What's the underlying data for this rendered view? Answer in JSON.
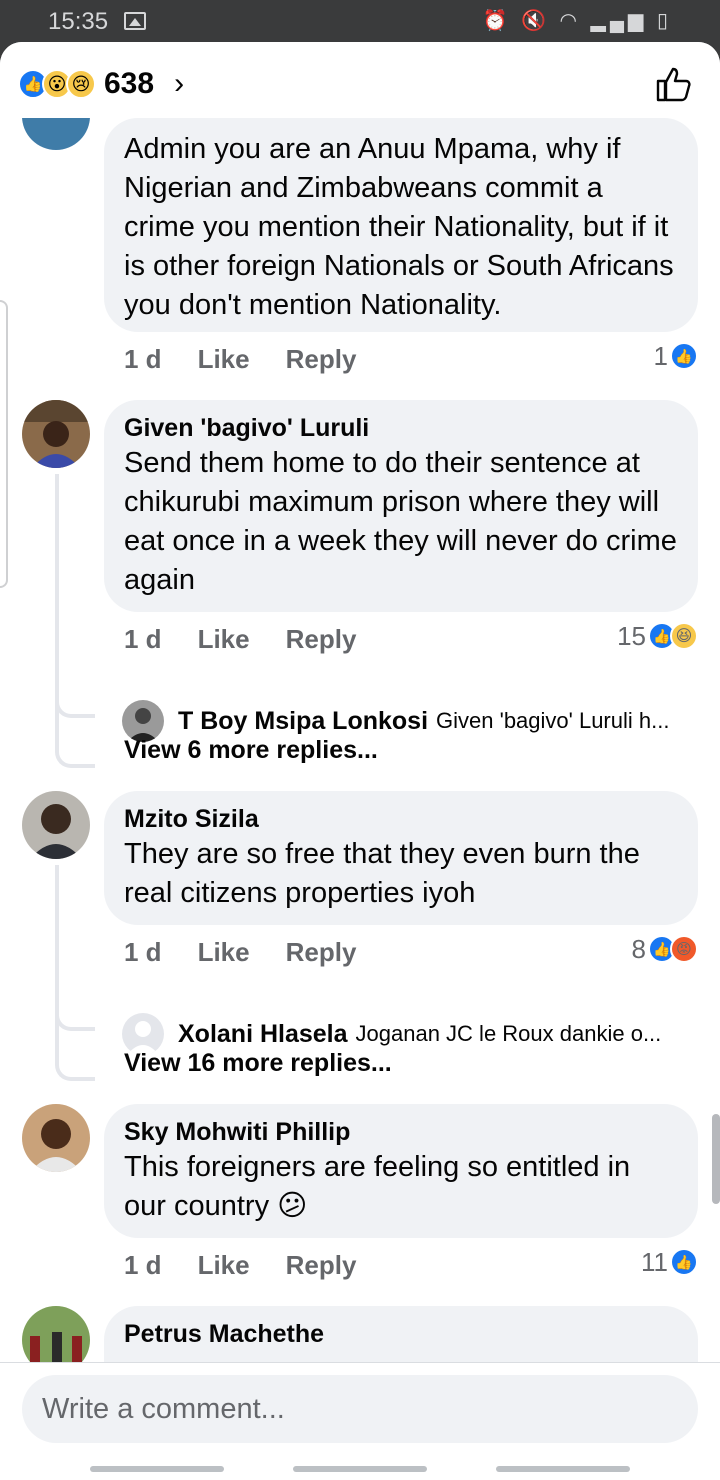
{
  "status_bar": {
    "time": "15:35",
    "right_icons": "⏰ 🔇 ◠ ▂▄▆ ▯"
  },
  "header": {
    "reaction_icons": [
      "like-icon",
      "wow-icon",
      "sad-icon"
    ],
    "reaction_count": "638",
    "chevron": "›",
    "like_button_icon": "thumbs-up-icon"
  },
  "colors": {
    "accent": "#1877f2",
    "bubble": "#f0f2f5",
    "meta_text": "#65676b"
  },
  "comments": [
    {
      "author": "",
      "text": "Admin you are an Anuu Mpama, why if Nigerian and Zimbabweans commit a crime you mention their Nationality, but if it is other foreign Nationals or South Africans you don't mention Nationality.",
      "time": "1 d",
      "like": "Like",
      "reply": "Reply",
      "reactions": "1"
    },
    {
      "author": "Given 'bagivo' Luruli",
      "text": "Send them home to do their sentence at chikurubi maximum prison where they will eat once in a week they will never do crime again",
      "time": "1 d",
      "like": "Like",
      "reply": "Reply",
      "reactions": "15",
      "reply_preview": {
        "author": "T Boy Msipa Lonkosi",
        "snippet": "Given 'bagivo' Luruli h..."
      },
      "view_more": "View 6 more replies..."
    },
    {
      "author": "Mzito Sizila",
      "text": "They are so free that they even burn the real citizens properties iyoh",
      "time": "1 d",
      "like": "Like",
      "reply": "Reply",
      "reactions": "8",
      "reply_preview": {
        "author": "Xolani Hlasela",
        "snippet": "Joganan JC le Roux dankie o..."
      },
      "view_more": "View 16 more replies..."
    },
    {
      "author": "Sky Mohwiti Phillip",
      "text": "This foreigners are feeling so entitled in our country 😕",
      "time": "1 d",
      "like": "Like",
      "reply": "Reply",
      "reactions": "11"
    },
    {
      "author": "Petrus Machethe",
      "text": ""
    }
  ],
  "composer": {
    "placeholder": "Write a comment..."
  }
}
